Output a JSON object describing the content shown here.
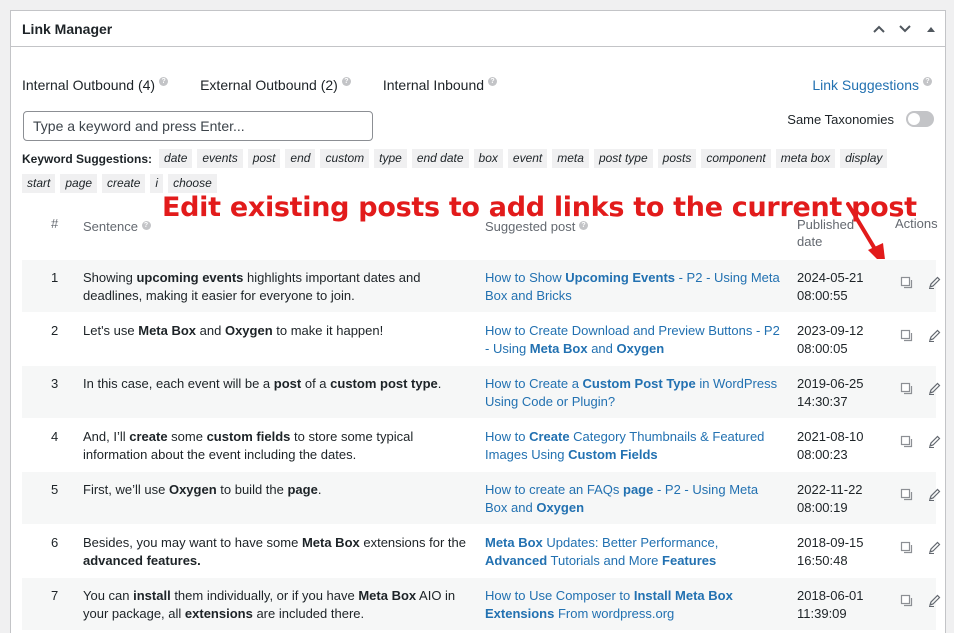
{
  "panel": {
    "title": "Link Manager"
  },
  "tabs": [
    {
      "label": "Internal Outbound (4)"
    },
    {
      "label": "External Outbound (2)"
    },
    {
      "label": "Internal Inbound"
    }
  ],
  "link_suggestions": "Link Suggestions",
  "search": {
    "placeholder": "Type a keyword and press Enter..."
  },
  "same_taxonomies": {
    "label": "Same Taxonomies",
    "enabled": false
  },
  "keywords": {
    "label": "Keyword Suggestions:",
    "items": [
      "date",
      "events",
      "post",
      "end",
      "custom",
      "type",
      "end date",
      "box",
      "event",
      "meta",
      "post type",
      "posts",
      "component",
      "meta box",
      "display",
      "start",
      "page",
      "create",
      "i",
      "choose"
    ]
  },
  "annotation": "Edit existing posts to add links to the current post",
  "table": {
    "headers": {
      "num": "#",
      "sentence": "Sentence",
      "suggested": "Suggested post",
      "published": "Published date",
      "actions": "Actions"
    },
    "rows": [
      {
        "num": "1",
        "sentence": [
          [
            "Showing ",
            0
          ],
          [
            "upcoming events",
            1
          ],
          [
            " highlights important dates and deadlines, making it easier for everyone to join.",
            0
          ]
        ],
        "post": [
          [
            "How to Show ",
            0
          ],
          [
            "Upcoming Events",
            1
          ],
          [
            " - P2 - Using Meta Box and Bricks",
            0
          ]
        ],
        "date": "2024-05-21",
        "time": "08:00:55"
      },
      {
        "num": "2",
        "sentence": [
          [
            "Let's use ",
            0
          ],
          [
            "Meta Box",
            1
          ],
          [
            " and ",
            0
          ],
          [
            "Oxygen",
            1
          ],
          [
            " to make it happen!",
            0
          ]
        ],
        "post": [
          [
            "How to Create Download and Preview Buttons - P2 - Using ",
            0
          ],
          [
            "Meta Box",
            1
          ],
          [
            " and ",
            0
          ],
          [
            "Oxygen",
            1
          ]
        ],
        "date": "2023-09-12",
        "time": "08:00:05"
      },
      {
        "num": "3",
        "sentence": [
          [
            "In this case, each event will be a ",
            0
          ],
          [
            "post",
            1
          ],
          [
            " of a ",
            0
          ],
          [
            "custom post type",
            1
          ],
          [
            ".",
            0
          ]
        ],
        "post": [
          [
            "How to Create a ",
            0
          ],
          [
            "Custom Post Type",
            1
          ],
          [
            " in WordPress Using Code or Plugin?",
            0
          ]
        ],
        "date": "2019-06-25",
        "time": "14:30:37"
      },
      {
        "num": "4",
        "sentence": [
          [
            "And, I’ll ",
            0
          ],
          [
            "create",
            1
          ],
          [
            " some ",
            0
          ],
          [
            "custom fields",
            1
          ],
          [
            " to store some typical information about the event including the dates.",
            0
          ]
        ],
        "post": [
          [
            "How to ",
            0
          ],
          [
            "Create",
            1
          ],
          [
            " Category Thumbnails & Featured Images Using ",
            0
          ],
          [
            "Custom Fields",
            1
          ]
        ],
        "date": "2021-08-10",
        "time": "08:00:23"
      },
      {
        "num": "5",
        "sentence": [
          [
            "First, we’ll use ",
            0
          ],
          [
            "Oxygen",
            1
          ],
          [
            " to build the ",
            0
          ],
          [
            "page",
            1
          ],
          [
            ".",
            0
          ]
        ],
        "post": [
          [
            "How to create an FAQs ",
            0
          ],
          [
            "page",
            1
          ],
          [
            " - P2 - Using Meta Box and ",
            0
          ],
          [
            "Oxygen",
            1
          ]
        ],
        "date": "2022-11-22",
        "time": "08:00:19"
      },
      {
        "num": "6",
        "sentence": [
          [
            "Besides, you may want to have some ",
            0
          ],
          [
            "Meta Box",
            1
          ],
          [
            " extensions for the ",
            0
          ],
          [
            "advanced features.",
            1
          ]
        ],
        "post": [
          [
            "Meta Box",
            1
          ],
          [
            " Updates: Better Performance, ",
            0
          ],
          [
            "Advanced",
            1
          ],
          [
            " Tutorials and More ",
            0
          ],
          [
            "Features",
            1
          ]
        ],
        "date": "2018-09-15",
        "time": "16:50:48"
      },
      {
        "num": "7",
        "sentence": [
          [
            "You can ",
            0
          ],
          [
            "install",
            1
          ],
          [
            " them individually, or if you have ",
            0
          ],
          [
            "Meta Box",
            1
          ],
          [
            " AIO in your package, all ",
            0
          ],
          [
            "extensions",
            1
          ],
          [
            " are included there.",
            0
          ]
        ],
        "post": [
          [
            "How to Use Composer to ",
            0
          ],
          [
            "Install Meta Box Extensions",
            1
          ],
          [
            " From wordpress.org",
            0
          ]
        ],
        "date": "2018-06-01",
        "time": "11:39:09"
      }
    ]
  }
}
